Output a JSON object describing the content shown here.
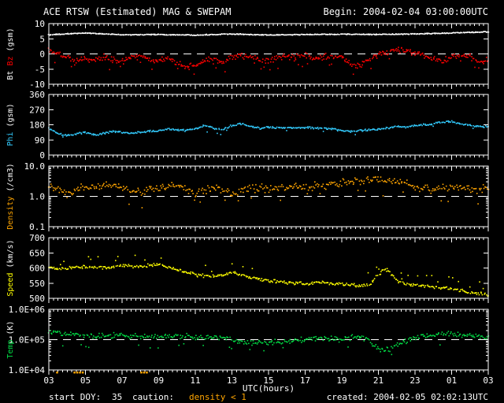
{
  "title": {
    "left": "ACE RTSW (Estimated) MAG & SWEPAM",
    "right": "Begin: 2004-02-04 03:00:00UTC"
  },
  "x_axis": {
    "label": "UTC(hours)",
    "start_hour": 3,
    "end_hour": 27,
    "tick_interval": 2,
    "minor_interval": 0.25,
    "tick_labels": [
      "03",
      "05",
      "07",
      "09",
      "11",
      "13",
      "15",
      "17",
      "19",
      "21",
      "23",
      "01",
      "03"
    ]
  },
  "footer": {
    "start_doy_label": "start DOY:",
    "start_doy_value": "35",
    "caution_label": "caution:",
    "caution_value": "density < 1",
    "caution_color": "#ffa500",
    "created": "created: 2004-02-05 02:02:13UTC"
  },
  "caution": {
    "color": "#ffa500",
    "hours": [
      3.45,
      4.4,
      4.55,
      4.7,
      4.85,
      8.05,
      8.2,
      8.35
    ]
  },
  "chart_data": [
    {
      "type": "scatter",
      "key": "bt-bz",
      "ylabel": [
        {
          "text": "Bt ",
          "color": "#ffffff"
        },
        {
          "text": "Bz",
          "color": "#ff0000"
        },
        {
          "text": " (gsm)",
          "color": "#ffffff"
        }
      ],
      "scale": "linear",
      "ylim": [
        -10,
        10
      ],
      "yticks": [
        {
          "v": 10,
          "label": "10"
        },
        {
          "v": 5,
          "label": "5"
        },
        {
          "v": 0,
          "label": "0"
        },
        {
          "v": -5,
          "label": "-5"
        },
        {
          "v": -10,
          "label": "-10"
        }
      ],
      "dashed_y": 0,
      "series": [
        {
          "name": "Bt",
          "color": "#ffffff",
          "n": 560,
          "jitter": 0.18,
          "x": [
            3,
            5,
            7,
            9,
            11,
            13,
            15,
            17,
            19,
            21,
            23,
            25,
            27
          ],
          "y": [
            6.3,
            6.9,
            6.3,
            6.4,
            6.2,
            6.6,
            6.2,
            6.4,
            6.5,
            6.4,
            6.6,
            6.9,
            7.3
          ]
        },
        {
          "name": "Bz",
          "color": "#ff0000",
          "n": 520,
          "jitter": 1.1,
          "spike": {
            "frac": 0.05,
            "amount": -2.5
          },
          "x": [
            3,
            3.5,
            4,
            4.5,
            5,
            5.5,
            6,
            6.5,
            7,
            7.5,
            8,
            8.5,
            9,
            9.5,
            10,
            10.5,
            11,
            11.5,
            12,
            12.5,
            13,
            13.5,
            14,
            14.5,
            15,
            15.5,
            16,
            16.5,
            17,
            17.5,
            18,
            18.5,
            19,
            19.5,
            20,
            20.5,
            21,
            21.5,
            22,
            22.5,
            23,
            23.5,
            24,
            24.5,
            25,
            25.5,
            26,
            26.5,
            27
          ],
          "y": [
            1.5,
            0,
            -1,
            -2.5,
            -1.5,
            -2,
            -1,
            -2,
            -2.5,
            -1,
            -0.5,
            -2,
            -2.5,
            -1.5,
            -3,
            -4.5,
            -3.5,
            -2,
            -1.5,
            -3,
            -1,
            -0.5,
            -1,
            -2,
            -2.5,
            -1,
            -0.5,
            -1,
            -0.5,
            -1.5,
            -1,
            -0.5,
            -1,
            -3.5,
            -4,
            -2,
            -0.5,
            0.5,
            1.5,
            1,
            0,
            -0.5,
            -1.5,
            -2.5,
            -1,
            -0.5,
            -1,
            -2.5,
            -2
          ]
        }
      ]
    },
    {
      "type": "scatter",
      "key": "phi",
      "ylabel": [
        {
          "text": "Phi",
          "color": "#33ccff"
        },
        {
          "text": " (gsm)",
          "color": "#ffffff"
        }
      ],
      "scale": "linear",
      "ylim": [
        0,
        360
      ],
      "yticks": [
        {
          "v": 360,
          "label": "360"
        },
        {
          "v": 270,
          "label": "270"
        },
        {
          "v": 180,
          "label": "180"
        },
        {
          "v": 90,
          "label": "90"
        },
        {
          "v": 0,
          "label": "0"
        }
      ],
      "dashed_y": null,
      "series": [
        {
          "name": "Phi",
          "color": "#33ccff",
          "n": 480,
          "jitter": 7,
          "spike": {
            "frac": 0.03,
            "amount": -25
          },
          "x": [
            3,
            3.5,
            4,
            4.5,
            5,
            5.5,
            6,
            6.5,
            7,
            7.5,
            8,
            8.5,
            9,
            9.5,
            10,
            10.5,
            11,
            11.5,
            12,
            12.5,
            13,
            13.5,
            14,
            14.5,
            15,
            15.5,
            16,
            16.5,
            17,
            17.5,
            18,
            18.5,
            19,
            19.5,
            20,
            20.5,
            21,
            21.5,
            22,
            22.5,
            23,
            23.5,
            24,
            24.5,
            25,
            25.5,
            26,
            26.5,
            27
          ],
          "y": [
            160,
            130,
            115,
            125,
            135,
            120,
            130,
            140,
            135,
            130,
            135,
            140,
            145,
            155,
            150,
            145,
            155,
            175,
            160,
            150,
            175,
            185,
            170,
            160,
            165,
            160,
            165,
            160,
            165,
            160,
            160,
            155,
            145,
            140,
            145,
            150,
            155,
            160,
            170,
            165,
            175,
            180,
            185,
            195,
            200,
            185,
            175,
            170,
            168
          ]
        }
      ]
    },
    {
      "type": "scatter",
      "key": "density",
      "ylabel": [
        {
          "text": "Density",
          "color": "#ffa500"
        },
        {
          "text": " (/cm3)",
          "color": "#ffffff"
        }
      ],
      "scale": "log",
      "ylim": [
        0.1,
        10
      ],
      "yticks": [
        {
          "v": 10,
          "label": "10.0"
        },
        {
          "v": 1,
          "label": "1.0"
        },
        {
          "v": 0.1,
          "label": "0.1"
        }
      ],
      "dashed_y": 1.0,
      "series": [
        {
          "name": "Density",
          "color": "#ffa500",
          "n": 430,
          "jitter": 0.16,
          "spike": {
            "frac": 0.07,
            "amount": -0.4
          },
          "x": [
            3,
            4,
            5,
            6,
            7,
            8,
            9,
            10,
            11,
            12,
            13,
            14,
            15,
            16,
            17,
            18,
            19,
            20,
            21,
            22,
            23,
            24,
            25,
            26,
            27
          ],
          "y": [
            2.2,
            1.2,
            2.0,
            2.2,
            2.0,
            1.4,
            2.0,
            2.2,
            1.3,
            2.0,
            1.2,
            2.0,
            1.8,
            2.0,
            2.2,
            2.4,
            2.8,
            3.2,
            3.8,
            3.0,
            2.0,
            1.6,
            2.0,
            1.8,
            2.0
          ]
        }
      ]
    },
    {
      "type": "scatter",
      "key": "speed",
      "ylabel": [
        {
          "text": "Speed",
          "color": "#ffff00"
        },
        {
          "text": " (km/s)",
          "color": "#ffffff"
        }
      ],
      "scale": "linear",
      "ylim": [
        500,
        700
      ],
      "yticks": [
        {
          "v": 700,
          "label": "700"
        },
        {
          "v": 650,
          "label": "650"
        },
        {
          "v": 600,
          "label": "600"
        },
        {
          "v": 550,
          "label": "550"
        },
        {
          "v": 500,
          "label": "500"
        }
      ],
      "dashed_y": null,
      "series": [
        {
          "name": "Speed",
          "color": "#ffff00",
          "n": 470,
          "jitter": 7,
          "spike": {
            "frac": 0.05,
            "amount": 30
          },
          "x": [
            3,
            4,
            5,
            6,
            7,
            8,
            9,
            10,
            11,
            12,
            13,
            14,
            15,
            16,
            17,
            18,
            19,
            20,
            20.5,
            21,
            21.4,
            22,
            22.5,
            23,
            24,
            25,
            26,
            27
          ],
          "y": [
            600,
            598,
            605,
            600,
            608,
            605,
            612,
            595,
            578,
            572,
            585,
            568,
            558,
            552,
            548,
            553,
            545,
            543,
            545,
            578,
            598,
            560,
            545,
            545,
            538,
            532,
            520,
            512
          ]
        }
      ]
    },
    {
      "type": "scatter",
      "key": "temp",
      "ylabel": [
        {
          "text": "Temp",
          "color": "#00dd44"
        },
        {
          "text": " (K)",
          "color": "#ffffff"
        }
      ],
      "scale": "log",
      "ylim": [
        10000,
        1000000
      ],
      "yticks": [
        {
          "v": 1000000,
          "label": "1.0E+06"
        },
        {
          "v": 100000,
          "label": "1.0E+05"
        },
        {
          "v": 10000,
          "label": "1.0E+04"
        }
      ],
      "dashed_y": 100000,
      "series": [
        {
          "name": "Temp",
          "color": "#00dd44",
          "n": 430,
          "jitter": 0.11,
          "spike": {
            "frac": 0.05,
            "amount": -0.35
          },
          "x": [
            3,
            4,
            5,
            6,
            7,
            8,
            9,
            10,
            11,
            12,
            13,
            14,
            15,
            16,
            17,
            18,
            19,
            20,
            21,
            21.5,
            22,
            23,
            24,
            25,
            25.5,
            26,
            26.5,
            27
          ],
          "y": [
            190000,
            150000,
            135000,
            130000,
            145000,
            125000,
            120000,
            135000,
            115000,
            120000,
            100000,
            75000,
            80000,
            90000,
            100000,
            115000,
            105000,
            125000,
            50000,
            45000,
            65000,
            115000,
            145000,
            160000,
            140000,
            150000,
            120000,
            115000
          ]
        }
      ]
    }
  ]
}
